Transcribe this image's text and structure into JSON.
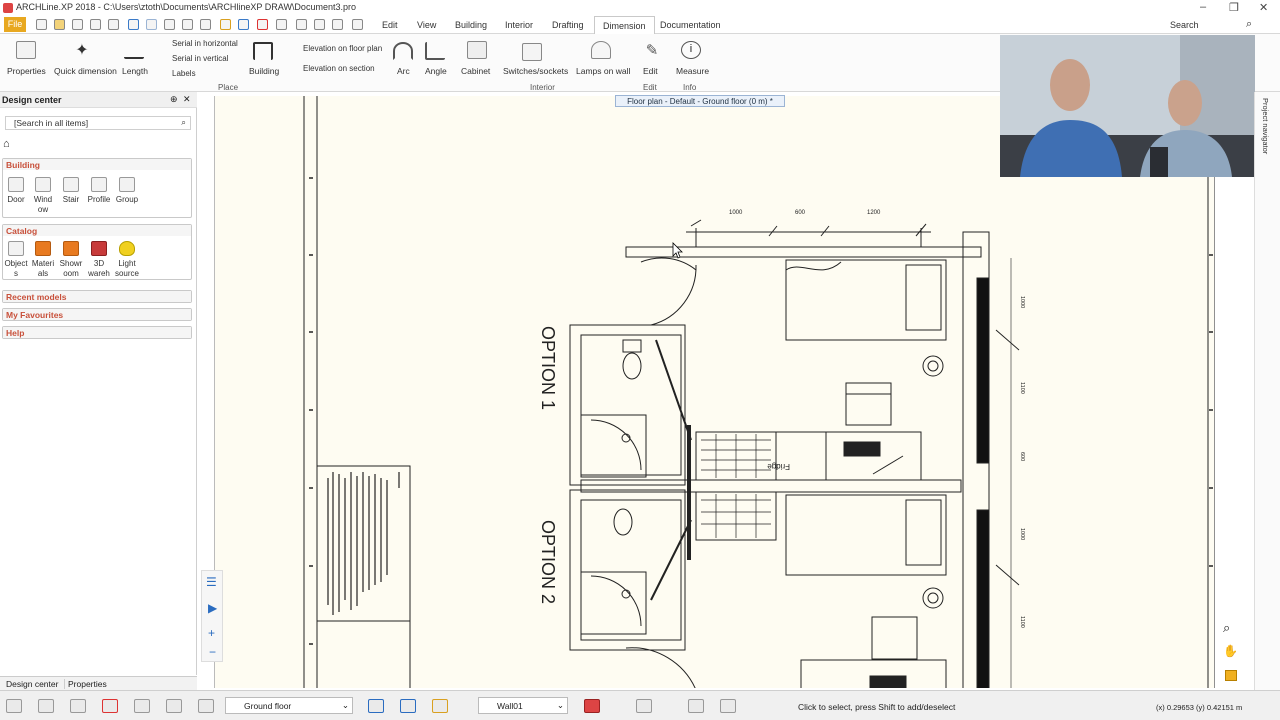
{
  "window": {
    "title": "ARCHLine.XP 2018 - C:\\Users\\ztoth\\Documents\\ARCHlineXP DRAW\\Document3.pro"
  },
  "menu": {
    "file": "File",
    "tabs": [
      "Edit",
      "View",
      "Building",
      "Interior",
      "Drafting",
      "Dimension",
      "Documentation"
    ],
    "active_tab": "Dimension",
    "search_label": "Search"
  },
  "ribbon": {
    "buttons": {
      "properties": "Properties",
      "quick_dimension": "Quick dimension",
      "length": "Length",
      "serial_horizontal": "Serial in horizontal",
      "serial_vertical": "Serial in vertical",
      "labels": "Labels",
      "building": "Building",
      "elevation_floor_plan": "Elevation on floor plan",
      "elevation_section": "Elevation on section",
      "arc": "Arc",
      "angle": "Angle",
      "cabinet": "Cabinet",
      "switches_sockets": "Switches/sockets",
      "lamps_on_wall": "Lamps on wall",
      "edit": "Edit",
      "measure": "Measure"
    },
    "groups": {
      "place": "Place",
      "interior": "Interior",
      "edit": "Edit",
      "info": "Info"
    }
  },
  "design_center": {
    "title": "Design center",
    "search_placeholder": "[Search in all items]",
    "sections": {
      "building": {
        "title": "Building",
        "items": [
          "Door",
          "Wind\now",
          "Stair",
          "Profile",
          "Group"
        ]
      },
      "catalog": {
        "title": "Catalog",
        "items": [
          "Object\ns",
          "Materi\nals",
          "Showr\noom",
          "3D\nwareh",
          "Light\nsource"
        ]
      },
      "recent": "Recent models",
      "favourites": "My Favourites",
      "help": "Help"
    }
  },
  "drawing": {
    "floor_plan_tab": "Floor plan - Default - Ground floor (0 m) *",
    "option1": "OPTION 1",
    "option2": "OPTION 2",
    "fridge_label": "Fridge",
    "dims_top": [
      "1000",
      "600",
      "1200"
    ],
    "dims_right": [
      "1000",
      "1100",
      "600",
      "1000",
      "1100"
    ]
  },
  "right_strip": {
    "label": "Project navigator"
  },
  "bottom_tabs": {
    "design_center": "Design center",
    "properties": "Properties"
  },
  "status": {
    "floor": "Ground floor",
    "layer": "Wall01",
    "hint": "Click to select, press Shift to add/deselect",
    "coords": "(x) 0.29653  (y) 0.42151 m"
  },
  "colors": {
    "file_button": "#e8a820",
    "section_header": "#c8503a",
    "sheet": "#fefcf2",
    "active_tab_border": "#9bb4d4"
  }
}
